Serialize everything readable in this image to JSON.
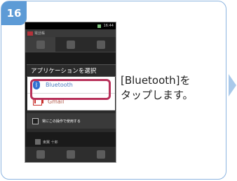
{
  "step": {
    "number": "16"
  },
  "phone": {
    "status_time": "16:44",
    "app_title": "電話帳",
    "dialog": {
      "title": "アプリケーションを選択",
      "options": [
        {
          "label": "Bluetooth",
          "icon": "bluetooth-icon"
        },
        {
          "label": "Gmail",
          "icon": "gmail-icon"
        }
      ],
      "default_checkbox_label": "常にこの操作で使用する"
    },
    "contact_name": "東翼 十郎"
  },
  "instruction": {
    "line1": "[Bluetooth]を",
    "line2": "タップします。"
  },
  "colors": {
    "badge": "#5d9bd6",
    "card_border": "#8cb4e0",
    "highlight": "#b8315a",
    "arrow": "#a9c9ea"
  }
}
